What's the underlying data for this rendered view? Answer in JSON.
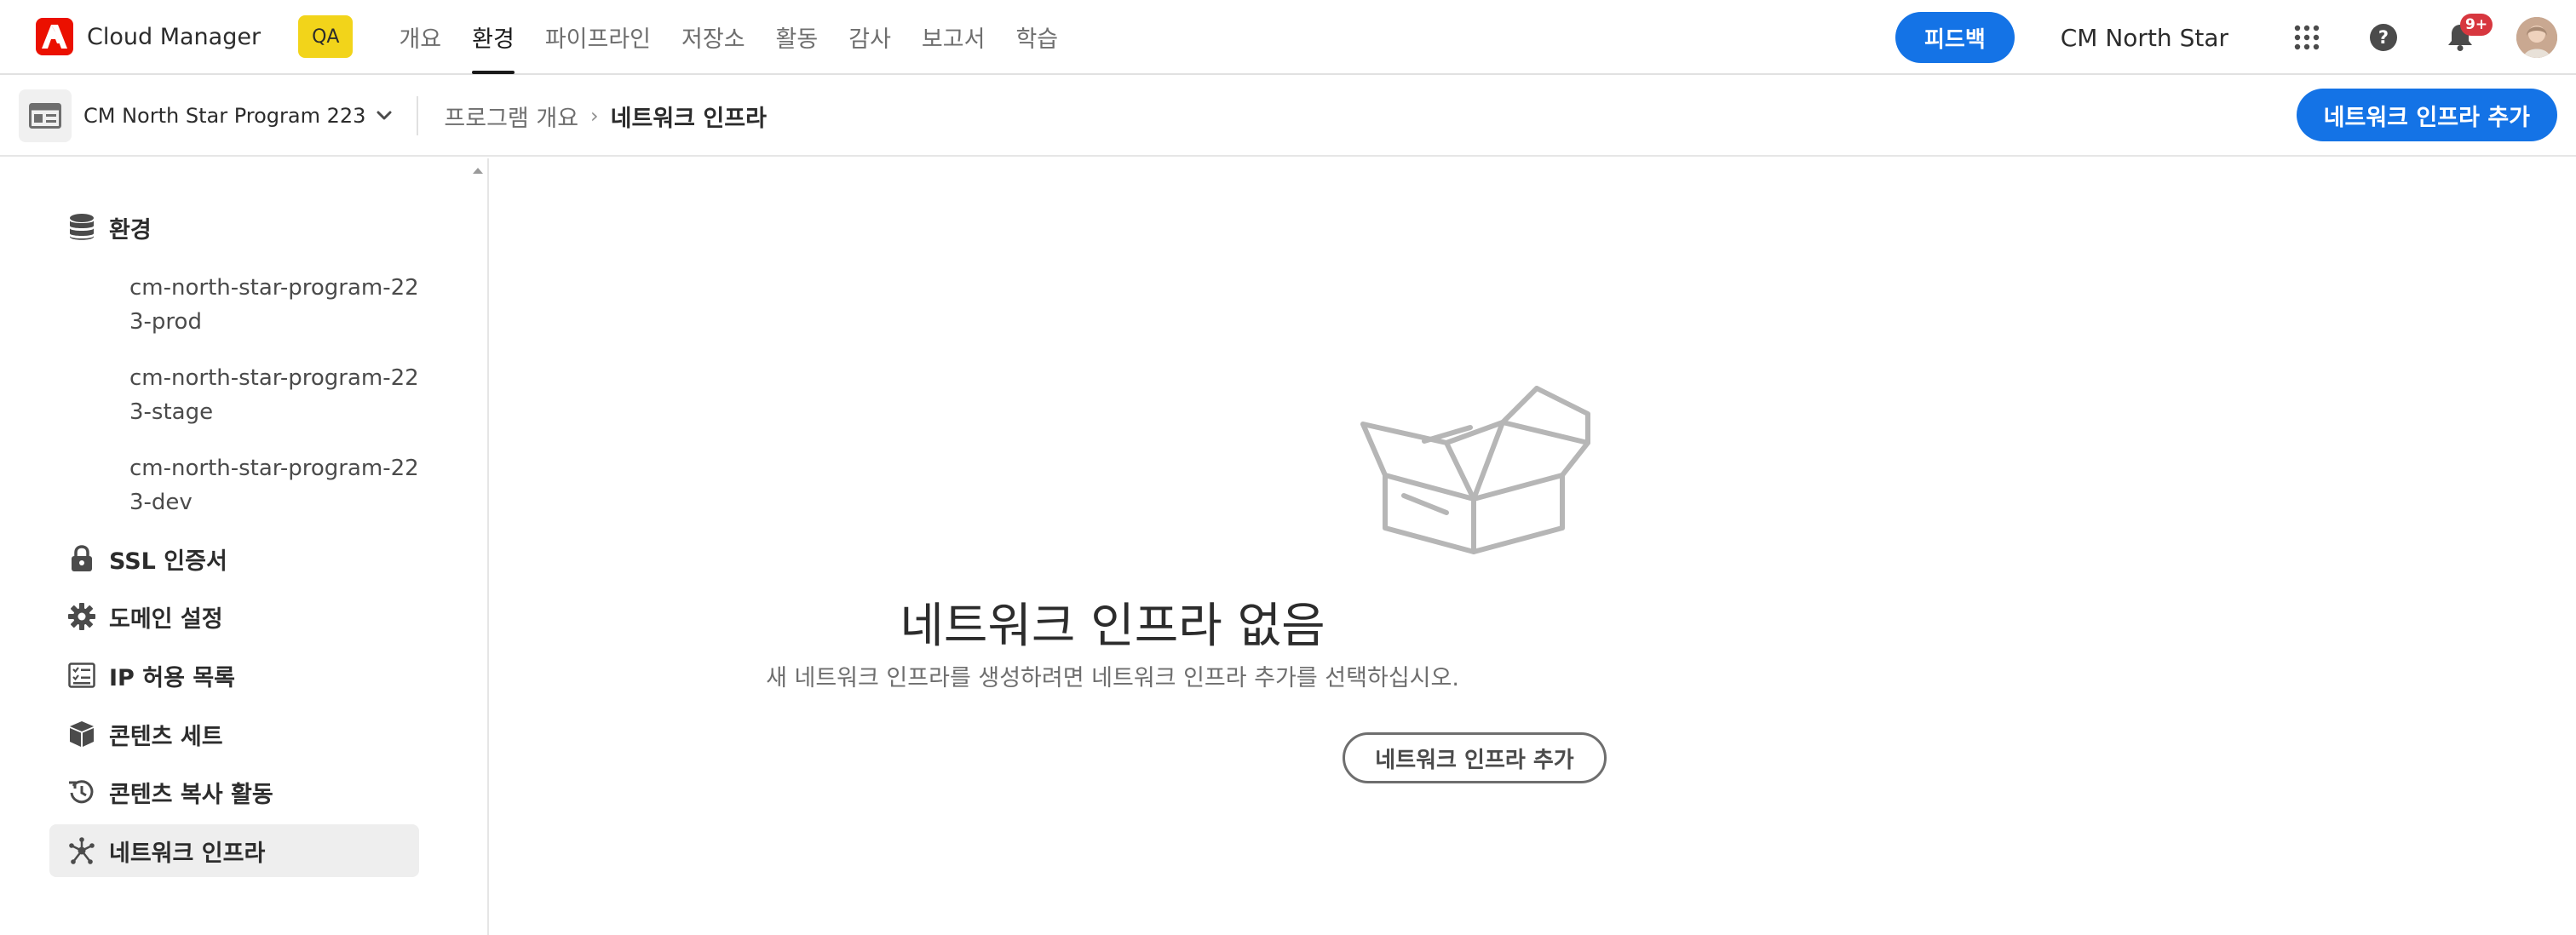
{
  "header": {
    "brand_name": "Cloud Manager",
    "env_badge": "QA",
    "tabs": [
      {
        "label": "개요",
        "active": false
      },
      {
        "label": "환경",
        "active": true
      },
      {
        "label": "파이프라인",
        "active": false
      },
      {
        "label": "저장소",
        "active": false
      },
      {
        "label": "활동",
        "active": false
      },
      {
        "label": "감사",
        "active": false
      },
      {
        "label": "보고서",
        "active": false
      },
      {
        "label": "학습",
        "active": false
      }
    ],
    "feedback_label": "피드백",
    "org_name": "CM North Star",
    "notification_count": "9+",
    "icons": [
      "apps-grid-icon",
      "help-icon",
      "bell-icon"
    ]
  },
  "subbar": {
    "program_name": "CM North Star Program 223",
    "breadcrumb": [
      "프로그램 개요",
      "네트워크 인프라"
    ],
    "add_button_label": "네트워크 인프라 추가"
  },
  "sidebar": {
    "environments_label": "환경",
    "environments": [
      "cm-north-star-program-223-prod",
      "cm-north-star-program-223-stage",
      "cm-north-star-program-223-dev"
    ],
    "items": [
      {
        "label": "SSL 인증서",
        "icon": "lock-icon"
      },
      {
        "label": "도메인 설정",
        "icon": "gear-icon"
      },
      {
        "label": "IP 허용 목록",
        "icon": "checklist-icon"
      },
      {
        "label": "콘텐츠 세트",
        "icon": "boxes-icon"
      },
      {
        "label": "콘텐츠 복사 활동",
        "icon": "history-icon"
      },
      {
        "label": "네트워크 인프라",
        "icon": "network-icon",
        "selected": true
      }
    ]
  },
  "empty_state": {
    "title": "네트워크 인프라 없음",
    "description": "새 네트워크 인프라를 생성하려면 네트워크 인프라 추가를 선택하십시오.",
    "button_label": "네트워크 인프라 추가"
  },
  "colors": {
    "accent": "#1473e6",
    "badge": "#f2d41a",
    "brand": "#eb1000",
    "notification": "#d7373f"
  }
}
